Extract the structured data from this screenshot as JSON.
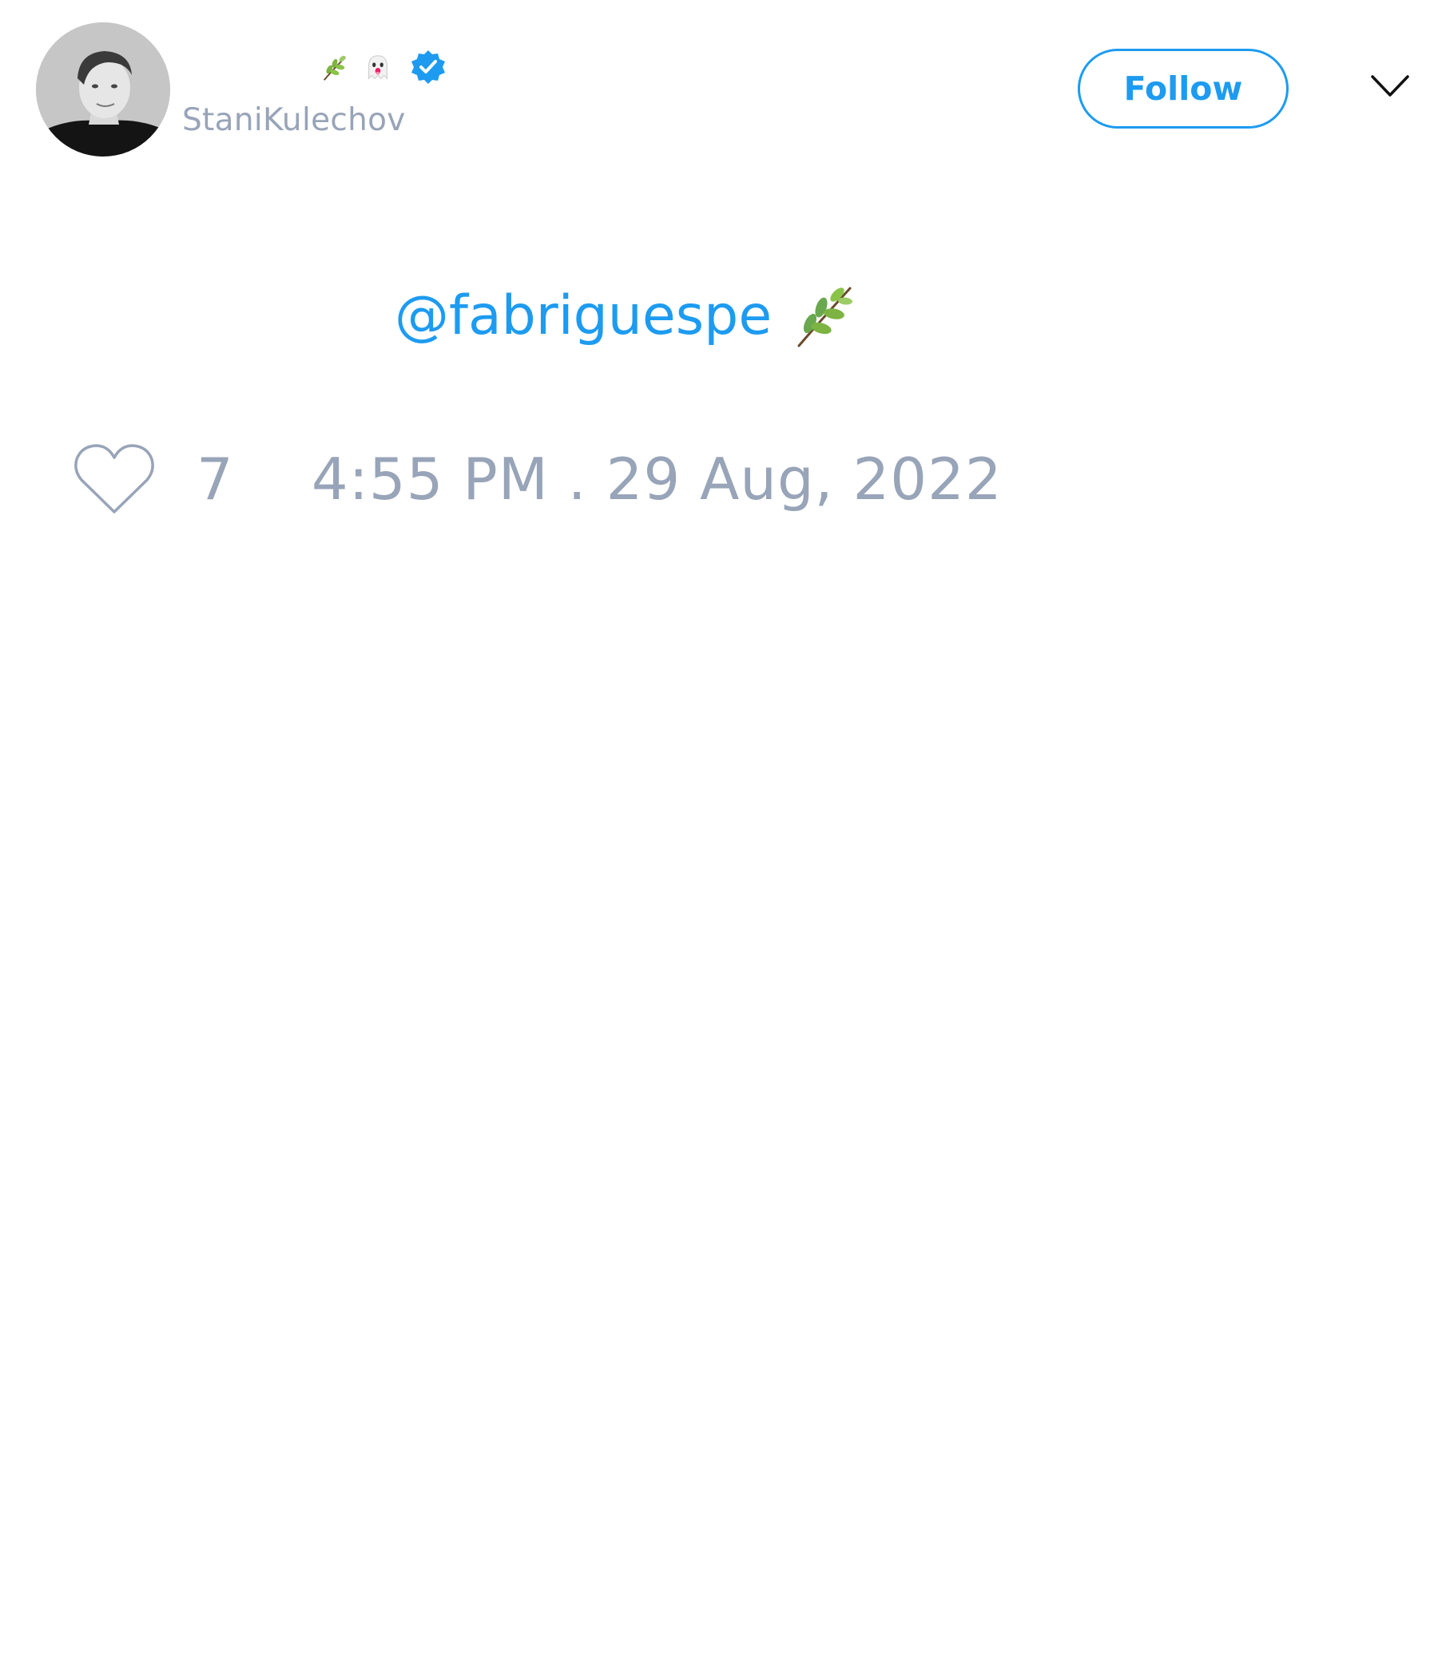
{
  "header": {
    "avatar_icon": "avatar-photo",
    "name_emojis": [
      "herb-emoji",
      "ghost-emoji"
    ],
    "verified_icon": "verified-badge-icon",
    "handle": "StaniKulechov",
    "follow_label": "Follow",
    "menu_icon": "chevron-down-icon"
  },
  "tweet": {
    "mention": "@fabriguespe",
    "emoji": "herb-emoji"
  },
  "footer": {
    "like_icon": "heart-icon",
    "like_count": "7",
    "timestamp": "4:55 PM . 29 Aug, 2022"
  },
  "colors": {
    "accent": "#1d9bf0",
    "muted_text": "#98a4b8",
    "background": "#ffffff"
  }
}
